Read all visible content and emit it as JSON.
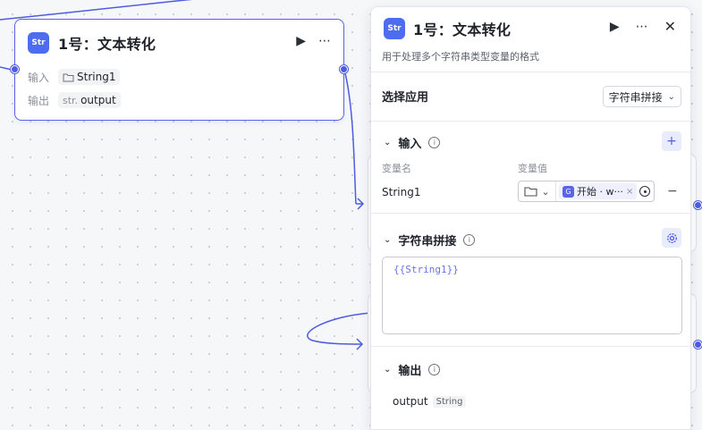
{
  "node": {
    "logo": "Str",
    "title": "1号：文本转化",
    "input_label": "输入",
    "input_var": "String1",
    "output_label": "输出",
    "output_type": "str.",
    "output_var": "output"
  },
  "panel": {
    "logo": "Str",
    "title": "1号：文本转化",
    "description": "用于处理多个字符串类型变量的格式",
    "select_app": {
      "label": "选择应用",
      "value": "字符串拼接"
    },
    "input_section": {
      "title": "输入",
      "add_label": "+",
      "col_name": "变量名",
      "col_value": "变量值",
      "rows": [
        {
          "name": "String1",
          "ref_tag_icon": "G",
          "ref_tag": "开始 · w···",
          "remove_label": "×",
          "delete_label": "−"
        }
      ]
    },
    "concat_section": {
      "title": "字符串拼接",
      "template": "{{String1}}"
    },
    "output_section": {
      "title": "输出",
      "var": "output",
      "type": "String"
    }
  },
  "colors": {
    "accent": "#4e5ce0",
    "logo": "#4e6cf0",
    "template_text": "#6a73e8"
  }
}
